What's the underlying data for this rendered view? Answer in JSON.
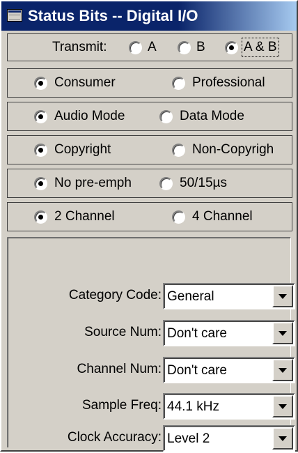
{
  "window": {
    "title": "Status Bits -- Digital I/O"
  },
  "transmit": {
    "label": "Transmit:",
    "options": [
      "A",
      "B",
      "A & B"
    ],
    "selected": "A & B"
  },
  "radio_rows": [
    {
      "left": "Consumer",
      "right": "Professional",
      "selected": "Consumer"
    },
    {
      "left": "Audio Mode",
      "right": "Data Mode",
      "selected": "Audio Mode"
    },
    {
      "left": "Copyright",
      "right": "Non-Copyrigh",
      "selected": "Copyright"
    },
    {
      "left": "No pre-emph",
      "right": "50/15µs",
      "selected": "No pre-emph"
    },
    {
      "left": "2 Channel",
      "right": "4 Channel",
      "selected": "2 Channel"
    }
  ],
  "fields": [
    {
      "label": "Category Code:",
      "value": "General"
    },
    {
      "label": "Source Num:",
      "value": "Don't care"
    },
    {
      "label": "Channel Num:",
      "value": "Don't care"
    },
    {
      "label": "Sample Freq:",
      "value": "44.1 kHz"
    },
    {
      "label": "Clock Accuracy:",
      "value": "Level 2"
    }
  ],
  "colors": {
    "titlebar": "#0a246a",
    "face": "#d4d0c8"
  }
}
